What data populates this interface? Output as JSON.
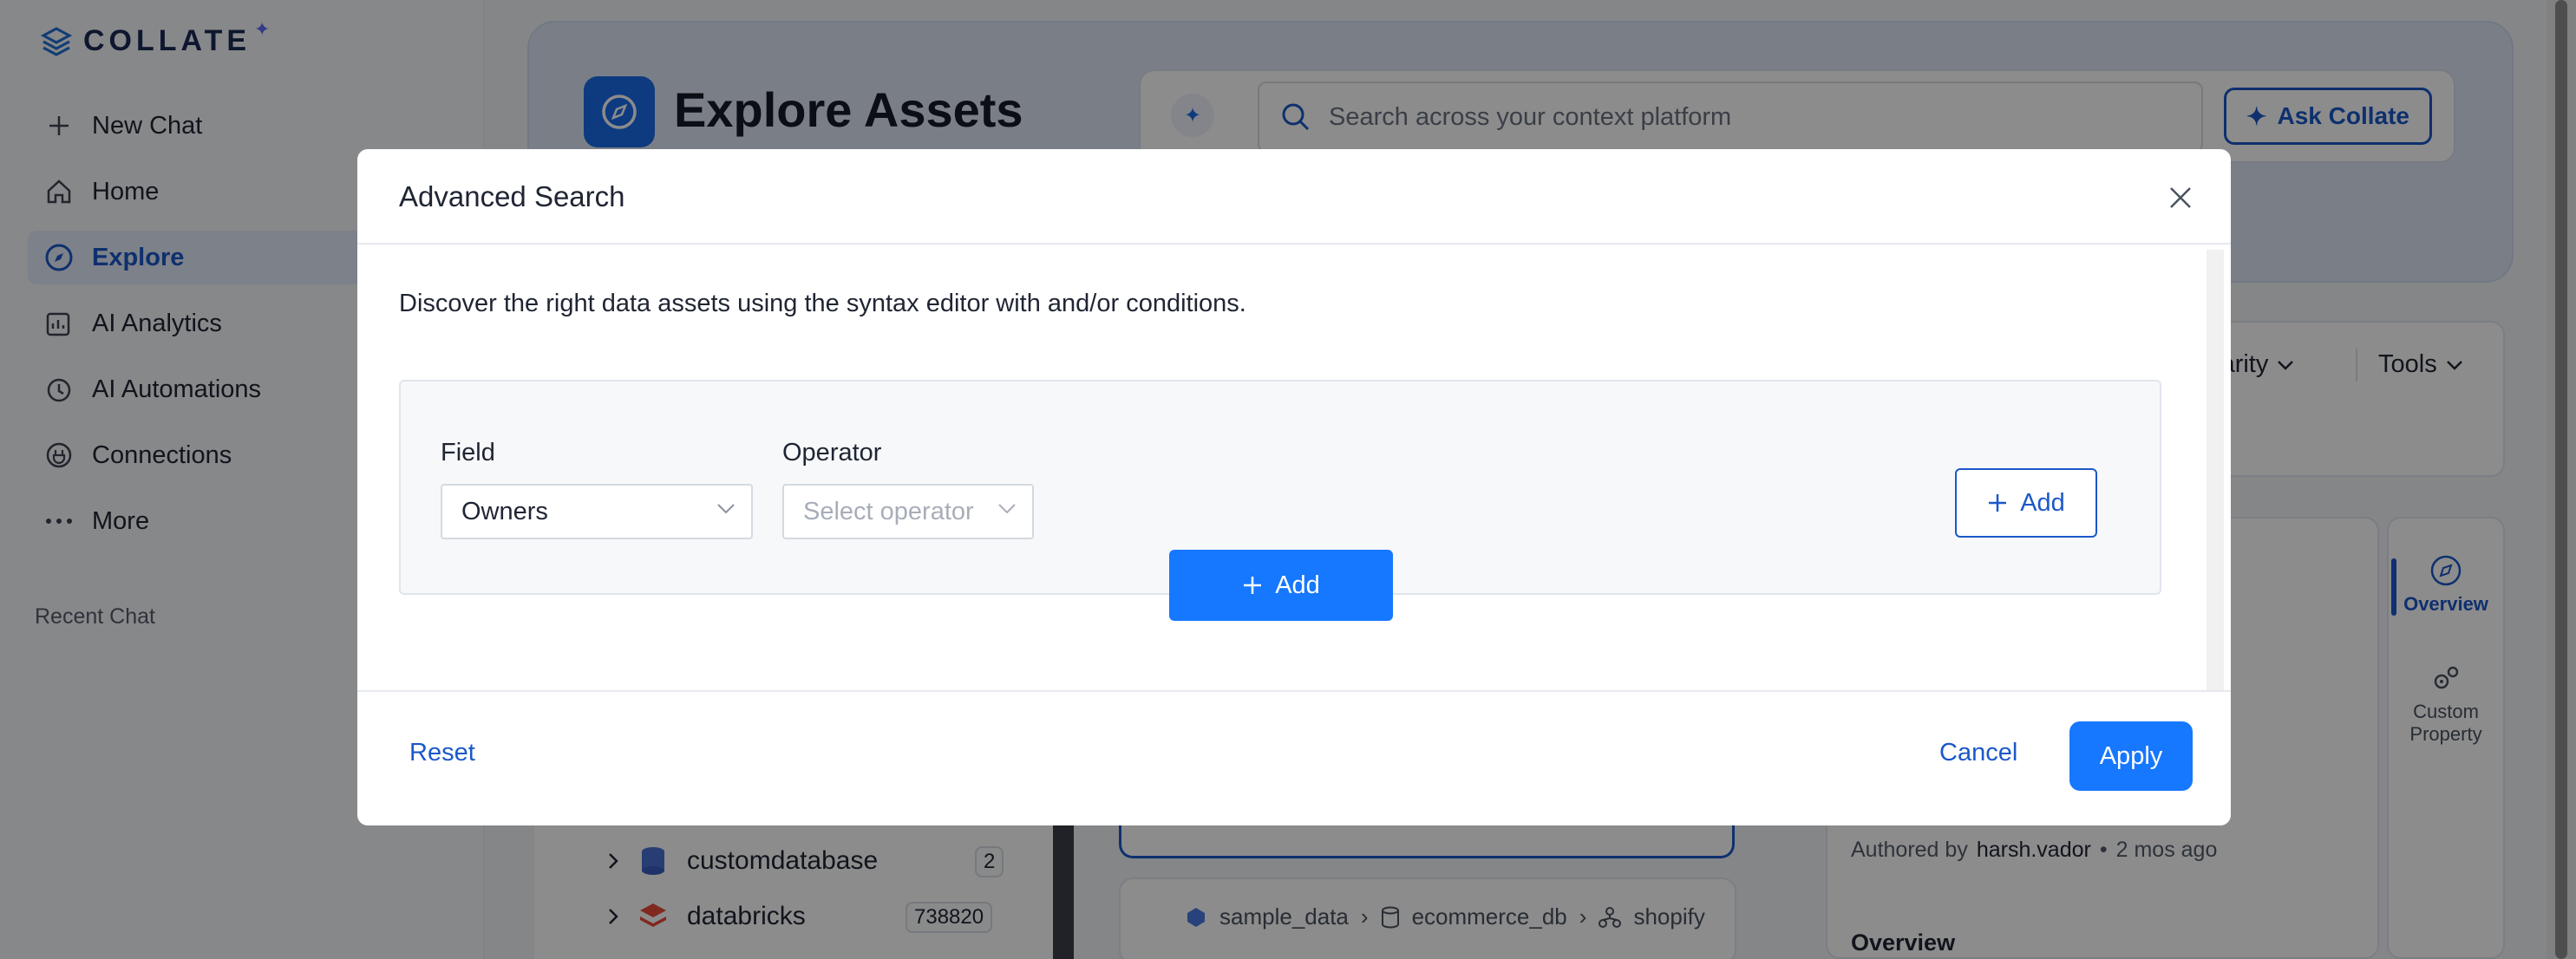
{
  "app": {
    "logo_text": "COLLATE"
  },
  "sidebar": {
    "items": [
      {
        "label": "New Chat",
        "icon": "plus-icon"
      },
      {
        "label": "Home",
        "icon": "home-icon"
      },
      {
        "label": "Explore",
        "icon": "compass-icon",
        "active": true
      },
      {
        "label": "AI Analytics",
        "icon": "analytics-icon"
      },
      {
        "label": "AI Automations",
        "icon": "automation-icon"
      },
      {
        "label": "Connections",
        "icon": "plug-icon"
      },
      {
        "label": "More",
        "icon": "ellipsis-icon"
      }
    ],
    "recent_chat_label": "Recent Chat"
  },
  "header": {
    "title": "Explore Assets",
    "search_placeholder": "Search across your context platform",
    "ask_button": "Ask Collate"
  },
  "filters": {
    "popularity": "ularity",
    "tools": "Tools"
  },
  "tree": {
    "rows": [
      {
        "label": "customdatabase",
        "count": "2"
      },
      {
        "label": "databricks",
        "count": "738820"
      }
    ]
  },
  "asset_card": {
    "breadcrumb": [
      "sample_data",
      "ecommerce_db",
      "shopify"
    ]
  },
  "details": {
    "authored_prefix": "Authored by",
    "author": "harsh.vador",
    "time": "2 mos ago",
    "overview_heading": "Overview",
    "rail": [
      {
        "label": "Overview",
        "icon": "compass-icon",
        "active": true
      },
      {
        "label": "Custom Property",
        "icon": "gears-icon"
      }
    ]
  },
  "modal": {
    "title": "Advanced Search",
    "description": "Discover the right data assets using the syntax editor with and/or conditions.",
    "field_label": "Field",
    "field_value": "Owners",
    "operator_label": "Operator",
    "operator_placeholder": "Select operator",
    "add_rule_label": "Add",
    "add_group_label": "Add",
    "reset_label": "Reset",
    "cancel_label": "Cancel",
    "apply_label": "Apply"
  },
  "colors": {
    "primary": "#1677ff",
    "link": "#1b58c9",
    "overlay": "rgba(0,0,0,0.45)"
  }
}
